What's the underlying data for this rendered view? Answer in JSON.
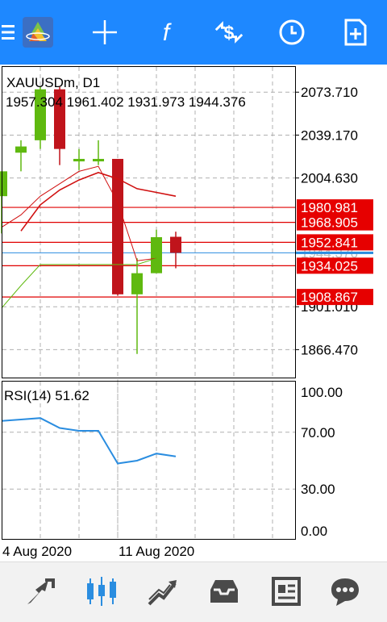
{
  "toolbar": {
    "items": [
      {
        "name": "menu",
        "icon": "hamburger-menu-icon"
      },
      {
        "name": "app-logo",
        "icon": "metatrader-logo-icon"
      },
      {
        "name": "crosshair",
        "icon": "crosshair-icon"
      },
      {
        "name": "indicators",
        "icon": "function-icon"
      },
      {
        "name": "symbols",
        "icon": "symbol-change-icon"
      },
      {
        "name": "timeframe",
        "icon": "clock-icon"
      },
      {
        "name": "new-order",
        "icon": "new-document-icon"
      }
    ],
    "bg_color": "#1e88ff"
  },
  "chart": {
    "symbol_title": "XAUUSDm, D1",
    "ohlc_text": "1957.304 1961.402 1931.973 1944.376",
    "price_axis_labels": [
      "2073.710",
      "2039.170",
      "2004.630",
      "1901.010",
      "1866.470"
    ],
    "hidden_price_label": "1944.376",
    "level_labels": [
      "1980.981",
      "1968.905",
      "1952.841",
      "1934.025",
      "1908.867"
    ],
    "date_labels": [
      "4 Aug 2020",
      "11 Aug 2020"
    ],
    "colors": {
      "bull": "#5fb90f",
      "bear": "#c0141b",
      "level": "#e00000",
      "rsi": "#2a8de0",
      "grid": "#b0b0b0",
      "current": "#2a8de0"
    }
  },
  "rsi": {
    "title": "RSI(14) 51.62",
    "axis_labels": [
      "100.00",
      "70.00",
      "30.00",
      "0.00"
    ]
  },
  "chart_data": {
    "type": "candlestick",
    "candles": [
      {
        "open": 1990,
        "high": 2010,
        "low": 1960,
        "close": 2010
      },
      {
        "open": 2025,
        "high": 2035,
        "low": 2010,
        "close": 2030
      },
      {
        "open": 2035,
        "high": 2078,
        "low": 2028,
        "close": 2076
      },
      {
        "open": 2076,
        "high": 2078,
        "low": 2015,
        "close": 2028
      },
      {
        "open": 2018,
        "high": 2028,
        "low": 2011,
        "close": 2020
      },
      {
        "open": 2018,
        "high": 2035,
        "low": 2015,
        "close": 2020
      },
      {
        "open": 2020,
        "high": 2020,
        "low": 1910,
        "close": 1911
      },
      {
        "open": 1911,
        "high": 1940,
        "low": 1863,
        "close": 1928
      },
      {
        "open": 1928,
        "high": 1963,
        "low": 1928,
        "close": 1957
      },
      {
        "open": 1957.304,
        "high": 1961.402,
        "low": 1931.973,
        "close": 1944.376
      }
    ],
    "levels": [
      1980.981,
      1968.905,
      1952.841,
      1934.025,
      1908.867
    ],
    "current_price": 1944.376,
    "ma_fast": [
      1965,
      1975,
      1990,
      2000,
      2010,
      2014,
      1985,
      1938,
      1940,
      null
    ],
    "ma_slow": [
      null,
      1962,
      1983,
      1995,
      2003,
      2009,
      2004,
      1996,
      1993,
      1990
    ],
    "ma_lower": [
      1900,
      1918,
      1935,
      1935,
      1935,
      1935,
      1935,
      1935,
      1940,
      null
    ],
    "rsi_values": [
      78,
      79,
      80,
      73,
      71,
      71,
      48,
      50,
      55,
      53
    ],
    "price_range": [
      1844,
      2094
    ],
    "rsi_range": [
      0,
      100
    ],
    "price_ticks": [
      2073.71,
      2039.17,
      2004.63,
      1901.01,
      1866.47
    ]
  },
  "bottom_nav": {
    "items": [
      {
        "name": "quotes",
        "icon": "quotes-arrows-icon"
      },
      {
        "name": "chart",
        "icon": "candlestick-icon",
        "active": true
      },
      {
        "name": "trade",
        "icon": "trade-trend-icon"
      },
      {
        "name": "history",
        "icon": "inbox-tray-icon"
      },
      {
        "name": "news",
        "icon": "newspaper-icon"
      },
      {
        "name": "messages",
        "icon": "chat-bubble-icon"
      }
    ]
  }
}
